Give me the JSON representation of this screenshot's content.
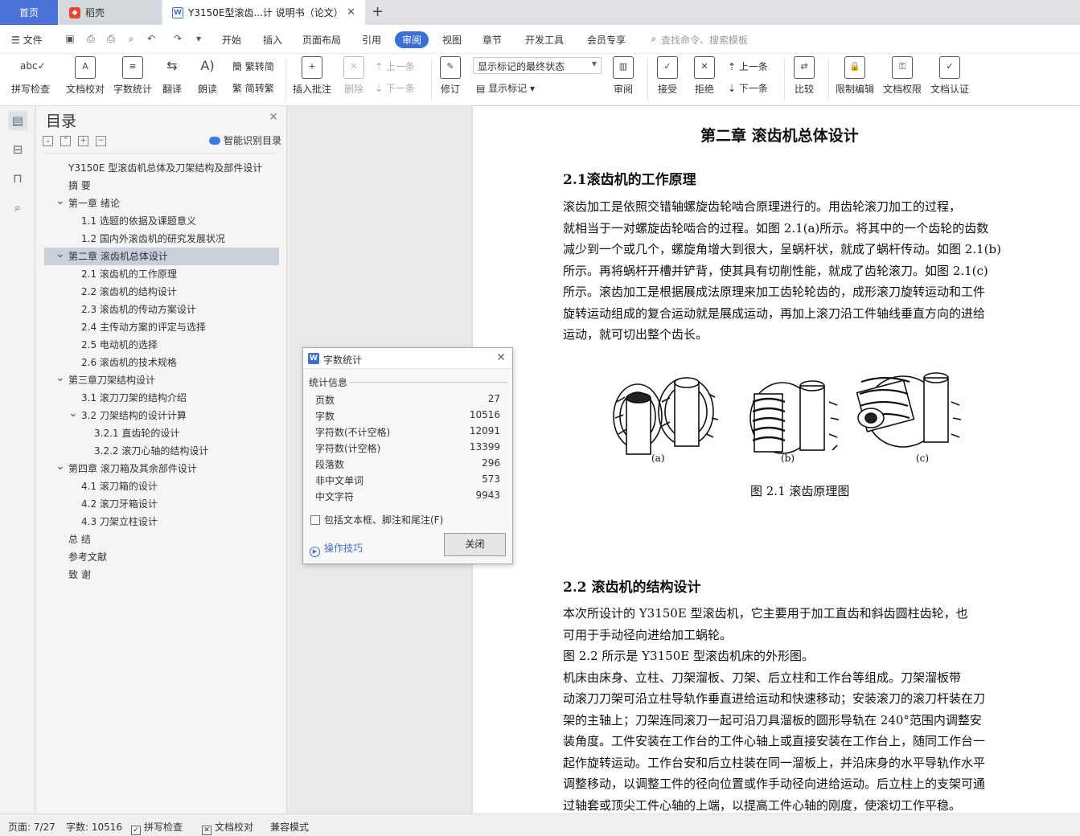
{
  "tabs": {
    "home": "首页",
    "daoke": "稻壳",
    "doc": "Y3150E型滚齿...计 说明书（论文）",
    "doc_icon": "W"
  },
  "menubar": {
    "file": "文件",
    "items": [
      "开始",
      "插入",
      "页面布局",
      "引用",
      "审阅",
      "视图",
      "章节",
      "开发工具",
      "会员专享"
    ],
    "search_placeholder": "查找命令、搜索模板"
  },
  "ribbon": {
    "spellcheck": "拼写检查",
    "proofread": "文档校对",
    "wordcount": "字数统计",
    "translate": "翻译",
    "read_aloud": "朗读",
    "trad_to_simp": "繁转简",
    "simp_to_trad": "简转繁",
    "insert_comment": "插入批注",
    "delete": "删除",
    "prev": "上一条",
    "next": "下一条",
    "track": "修订",
    "markup_mode": "显示标记的最终状态",
    "show_markup": "显示标记",
    "review": "审阅",
    "accept": "接受",
    "reject": "拒绝",
    "prev2": "上一条",
    "next2": "下一条",
    "compare": "比较",
    "restrict_edit": "限制编辑",
    "doc_permission": "文档权限",
    "doc_certify": "文档认证"
  },
  "toc": {
    "title": "目录",
    "smart": "智能识别目录",
    "items": [
      {
        "label": "Y3150E 型滚齿机总体及刀架结构及部件设计",
        "level": 0
      },
      {
        "label": "摘  要",
        "level": 0
      },
      {
        "label": "第一章  绪论",
        "level": 0,
        "arrow": "open"
      },
      {
        "label": "1.1 选题的依据及课题意义",
        "level": 1
      },
      {
        "label": "1.2 国内外滚齿机的研究发展状况",
        "level": 1
      },
      {
        "label": "第二章  滚齿机总体设计",
        "level": 0,
        "arrow": "open",
        "selected": true
      },
      {
        "label": "2.1 滚齿机的工作原理",
        "level": 1
      },
      {
        "label": "2.2  滚齿机的结构设计",
        "level": 1
      },
      {
        "label": "2.3  滚齿机的传动方案设计",
        "level": 1
      },
      {
        "label": "2.4 主传动方案的评定与选择",
        "level": 1
      },
      {
        "label": "2.5 电动机的选择",
        "level": 1
      },
      {
        "label": "2.6 滚齿机的技术规格",
        "level": 1
      },
      {
        "label": "第三章刀架结构设计",
        "level": 0,
        "arrow": "open"
      },
      {
        "label": "3.1 滚刀刀架的结构介绍",
        "level": 1
      },
      {
        "label": "3.2  刀架结构的设计计算",
        "level": 1,
        "arrow": "open"
      },
      {
        "label": "3.2.1  直齿轮的设计",
        "level": 2
      },
      {
        "label": "3.2.2  滚刀心轴的结构设计",
        "level": 2
      },
      {
        "label": "第四章  滚刀箱及其余部件设计",
        "level": 0,
        "arrow": "open"
      },
      {
        "label": "4.1 滚刀箱的设计",
        "level": 1
      },
      {
        "label": "4.2  滚刀牙箱设计",
        "level": 1
      },
      {
        "label": "4.3  刀架立柱设计",
        "level": 1
      },
      {
        "label": "总      结",
        "level": 0
      },
      {
        "label": "参考文献",
        "level": 0
      },
      {
        "label": "致      谢",
        "level": 0
      }
    ]
  },
  "page": {
    "chapter_title": "第二章  滚齿机总体设计",
    "s21_title": "2.1滚齿机的工作原理",
    "s21_lines": [
      "    滚齿加工是依照交错轴螺旋齿轮啮合原理进行的。用齿轮滚刀加工的过程，",
      "就相当于一对螺旋齿轮啮合的过程。如图 2.1(a)所示。将其中的一个齿轮的齿数",
      "减少到一个或几个，螺旋角增大到很大，呈蜗杆状，就成了蜗杆传动。如图 2.1(b)",
      "所示。再将蜗杆开槽并铲背，使其具有切削性能，就成了齿轮滚刀。如图 2.1(c)",
      "所示。滚齿加工是根据展成法原理来加工齿轮轮齿的，成形滚刀旋转运动和工件",
      "旋转运动组成的复合运动就是展成运动，再加上滚刀沿工件轴线垂直方向的进给",
      "运动，就可切出整个齿长。"
    ],
    "fig_labels": [
      "(a)",
      "(b)",
      "(c)"
    ],
    "fig_caption": "图 2.1 滚齿原理图",
    "s22_title": "2.2 滚齿机的结构设计",
    "s22_lines": [
      "    本次所设计的 Y3150E 型滚齿机，它主要用于加工直齿和斜齿圆柱齿轮，也",
      "可用于手动径向进给加工蜗轮。",
      "    图 2.2 所示是 Y3150E 型滚齿机床的外形图。",
      "    机床由床身、立柱、刀架溜板、刀架、后立柱和工作台等组成。刀架溜板带",
      "动滚刀刀架可沿立柱导轨作垂直进给运动和快速移动；安装滚刀的滚刀杆装在刀",
      "架的主轴上；刀架连同滚刀一起可沿刀具溜板的圆形导轨在 240°范围内调整安",
      "装角度。工件安装在工作台的工件心轴上或直接安装在工作台上，随同工作台一",
      "起作旋转运动。工作台安和后立柱装在同一溜板上，并沿床身的水平导轨作水平",
      "调整移动，以调整工件的径向位置或作手动径向进给运动。后立柱上的支架可通",
      "过轴套或顶尖工件心轴的上端，以提高工件心轴的刚度，使滚切工作平稳。"
    ]
  },
  "dialog": {
    "title": "字数统计",
    "section": "统计信息",
    "stats": [
      {
        "label": "页数",
        "value": "27"
      },
      {
        "label": "字数",
        "value": "10516"
      },
      {
        "label": "字符数(不计空格)",
        "value": "12091"
      },
      {
        "label": "字符数(计空格)",
        "value": "13399"
      },
      {
        "label": "段落数",
        "value": "296"
      },
      {
        "label": "非中文单词",
        "value": "573"
      },
      {
        "label": "中文字符",
        "value": "9943"
      }
    ],
    "include_label": "包括文本框、脚注和尾注(F)",
    "tips": "操作技巧",
    "close": "关闭"
  },
  "status": {
    "page": "页面: 7/27",
    "words": "字数: 10516",
    "spell": "拼写检查",
    "proof": "文档校对",
    "compat": "兼容模式"
  }
}
